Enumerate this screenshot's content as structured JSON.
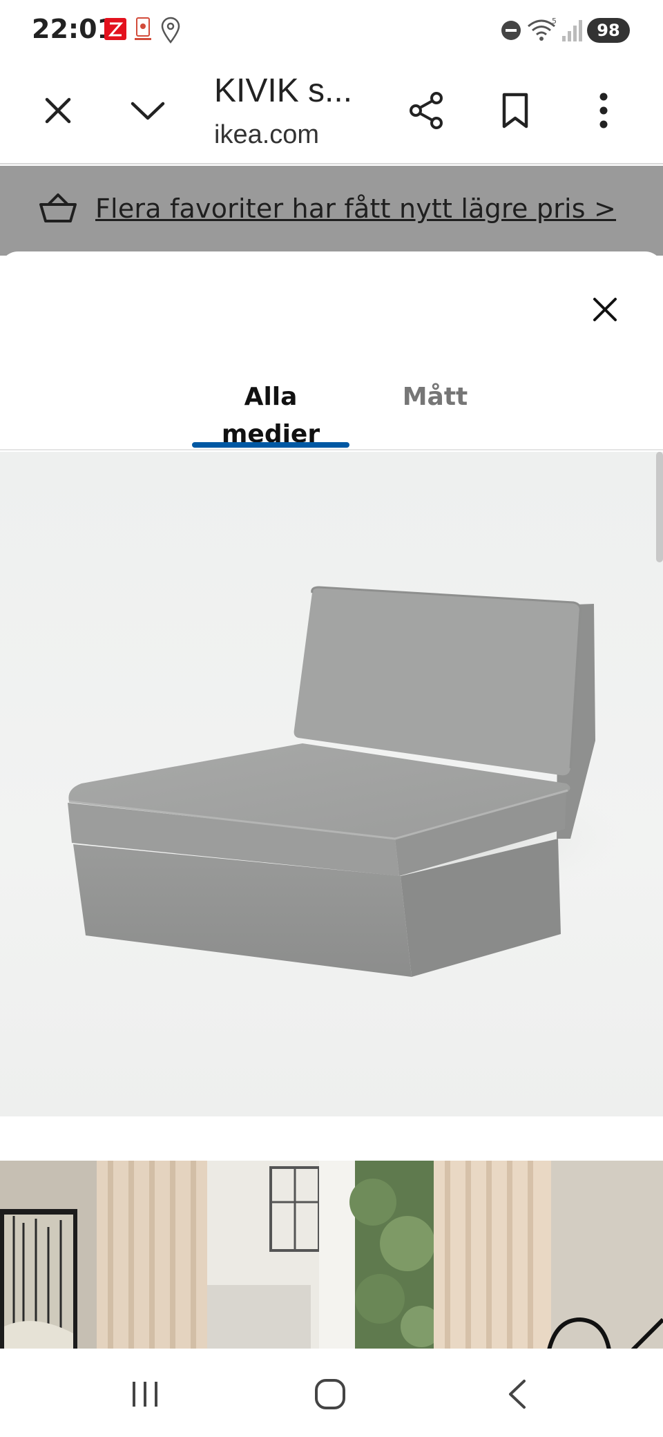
{
  "status_bar": {
    "time": "22:01",
    "battery": "98",
    "icons": [
      "notification-z-icon",
      "notification-app-icon",
      "location-icon",
      "do-not-disturb-icon",
      "wifi-icon",
      "signal-icon"
    ]
  },
  "browser": {
    "title": "KIVIK s...",
    "url": "ikea.com",
    "icons": [
      "close-icon",
      "chevron-down-icon",
      "share-icon",
      "bookmark-icon",
      "more-vert-icon"
    ]
  },
  "banner": {
    "text": "Flera favoriter har fått nytt lägre pris >"
  },
  "sheet": {
    "tabs": [
      {
        "label": "Alla medier",
        "active": true
      },
      {
        "label": "Mått",
        "active": false
      }
    ],
    "accent_color": "#0058a3"
  },
  "nav_bar": {
    "icons": [
      "recent-apps-icon",
      "home-icon",
      "back-icon"
    ]
  }
}
